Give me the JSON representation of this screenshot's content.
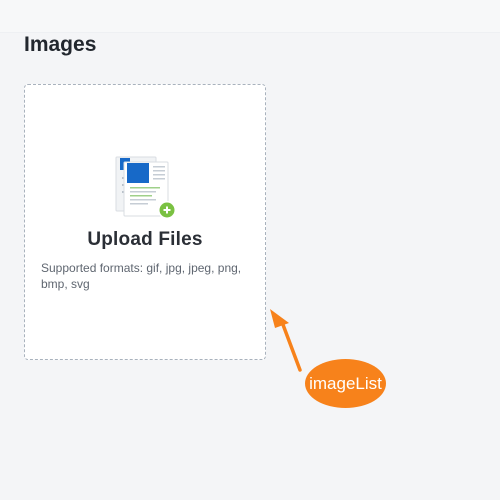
{
  "section": {
    "title": "Images"
  },
  "upload": {
    "icon": "upload-files-icon",
    "title": "Upload Files",
    "formats": "Supported formats: gif, jpg, jpeg, png, bmp, svg"
  },
  "annotation": {
    "label": "imageList",
    "color": "#f7821b"
  },
  "colors": {
    "accent_blue": "#1769c8",
    "add_badge_green": "#7ac142"
  }
}
